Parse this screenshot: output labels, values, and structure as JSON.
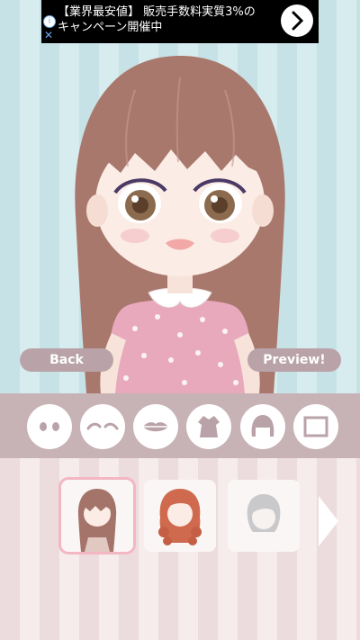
{
  "ad": {
    "text_line1": "【業界最安値】 販売手数料実質3%の",
    "text_line2": "キャンペーン開催中",
    "info_symbol": "i",
    "close_symbol": "✕"
  },
  "buttons": {
    "back_label": "Back",
    "preview_label": "Preview!"
  },
  "categories": [
    {
      "name": "eyes",
      "icon": "eyes-icon"
    },
    {
      "name": "eyebrows",
      "icon": "eyebrows-icon"
    },
    {
      "name": "lips",
      "icon": "lips-icon"
    },
    {
      "name": "dress",
      "icon": "dress-icon"
    },
    {
      "name": "hair",
      "icon": "hair-icon"
    },
    {
      "name": "background",
      "icon": "frame-icon"
    }
  ],
  "items": [
    {
      "name": "long-brown-hair",
      "color": "#a4746a",
      "selected": true
    },
    {
      "name": "curly-red-hair",
      "color": "#d06a4f",
      "selected": false
    },
    {
      "name": "short-silver-hair",
      "color": "#c9c9cc",
      "selected": false
    }
  ],
  "colors": {
    "stage_stripe_a": "#c6e2e6",
    "stage_stripe_b": "#d7ecee",
    "category_bar": "#c7b2b5",
    "button": "#b9a3a8",
    "selected_border": "#f3b7c3"
  }
}
